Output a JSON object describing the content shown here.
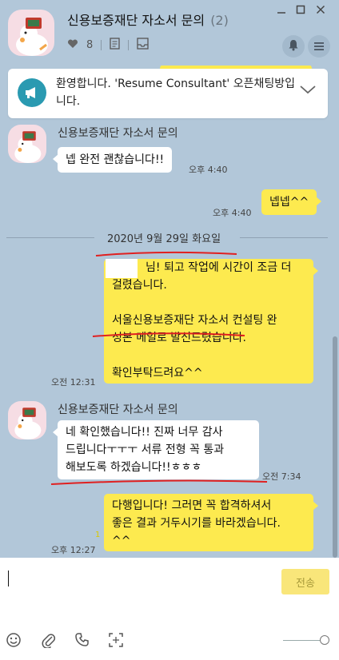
{
  "header": {
    "title": "신용보증재단 자소서 문의",
    "member_count": "(2)",
    "likes": "8"
  },
  "notice": {
    "text": "환영합니다. 'Resume Consultant' 오픈채팅방입니다."
  },
  "messages": [
    {
      "sender": "신용보증재단 자소서 문의",
      "text": "넵 완전 괜찮습니다!!",
      "time": "오후 4:40"
    },
    {
      "text": "넵넵^^",
      "time": "오후 4:40"
    },
    {
      "date": "2020년 9월 29일 화요일"
    },
    {
      "lines": [
        "님! 퇴고 작업에 시간이 조금 더",
        "걸렸습니다.",
        "",
        "서울신용보증재단 자소서 컨설팅 완",
        "성본 메일로 발신드렸습니다.",
        "",
        "확인부탁드려요^^"
      ],
      "time": "오전 12:31"
    },
    {
      "sender": "신용보증재단 자소서 문의",
      "lines": [
        "네 확인했습니다!! 진짜 너무 감사",
        "드립니다ㅜㅜㅜ 서류 전형 꼭 통과",
        "해보도록 하겠습니다!!ㅎㅎㅎ"
      ],
      "time": "오전 7:34"
    },
    {
      "lines": [
        "다행입니다! 그러면 꼭 합격하셔서",
        "좋은 결과 거두시기를 바라겠습니다.",
        "^^"
      ],
      "unread": "1",
      "time": "오후 12:27"
    }
  ],
  "input": {
    "send_label": "전송"
  },
  "colors": {
    "chat_bg": "#b2c7d9",
    "my_bubble": "#fdea4f",
    "their_bubble": "#ffffff",
    "annotation_red": "#e02020"
  }
}
